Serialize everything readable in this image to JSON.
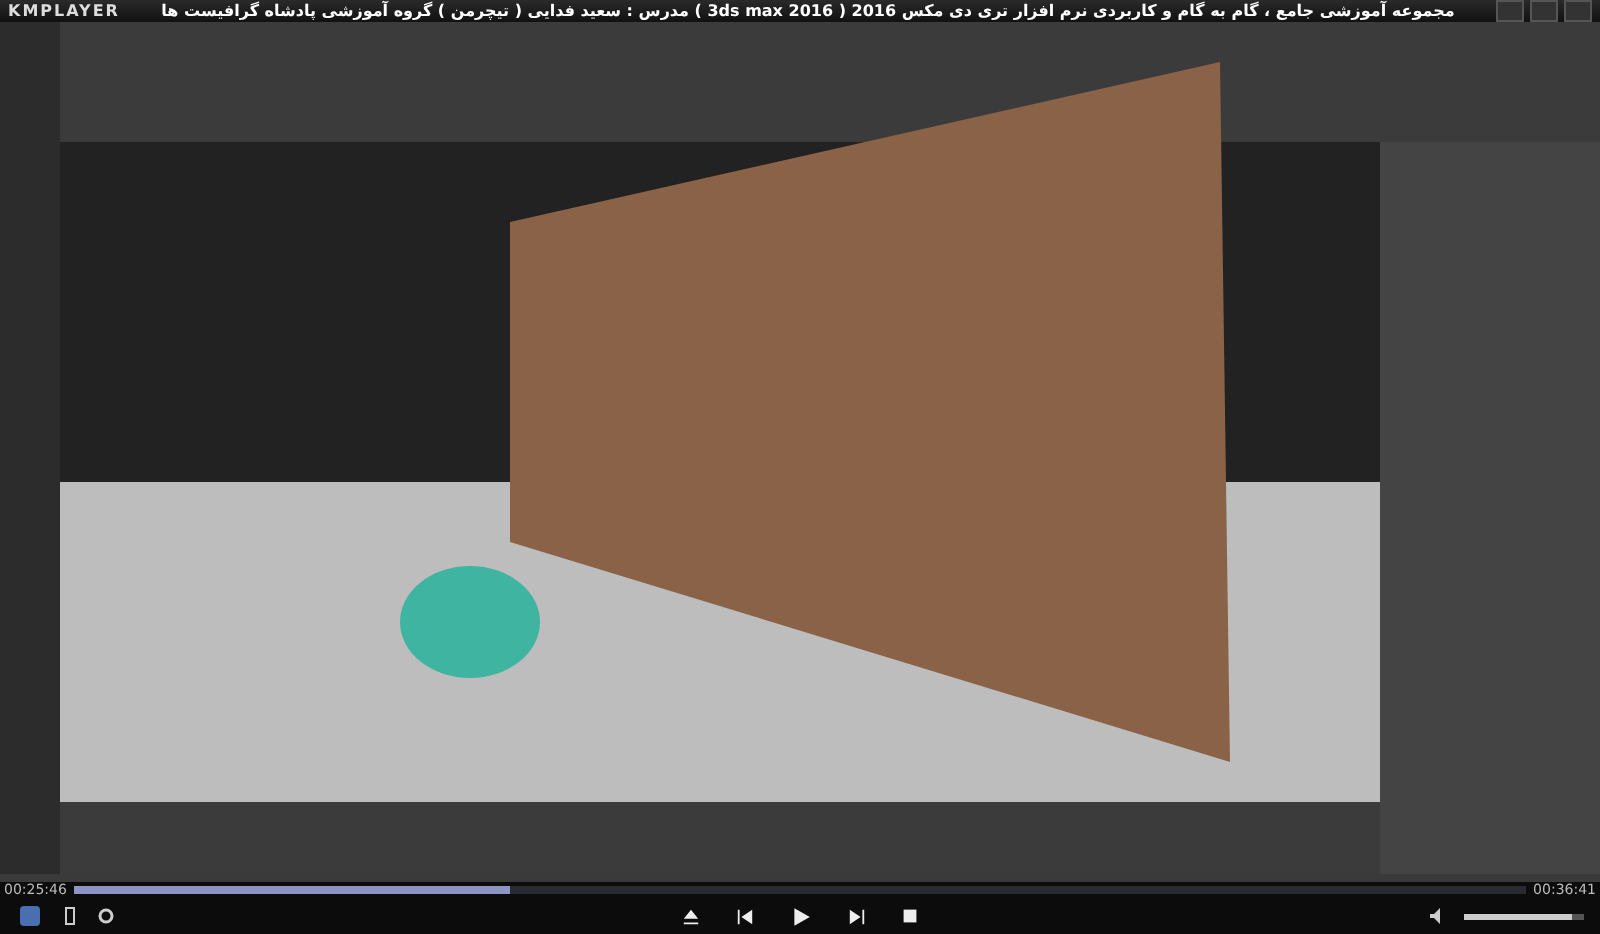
{
  "window": {
    "app_name": "KMPLAYER",
    "title": "مجموعه آموزشی جامع ، گام به گام و کاربردی نرم افزار تری دی مکس 2016 ( 3ds max 2016 ) مدرس : سعید فدایی ( تیچرمن ) گروه آموزشی پادشاه گرافیست ها"
  },
  "playback": {
    "elapsed": "00:25:46",
    "total": "00:36:41",
    "level": 0.3,
    "playing": false
  },
  "volume": {
    "level": 0.9
  }
}
